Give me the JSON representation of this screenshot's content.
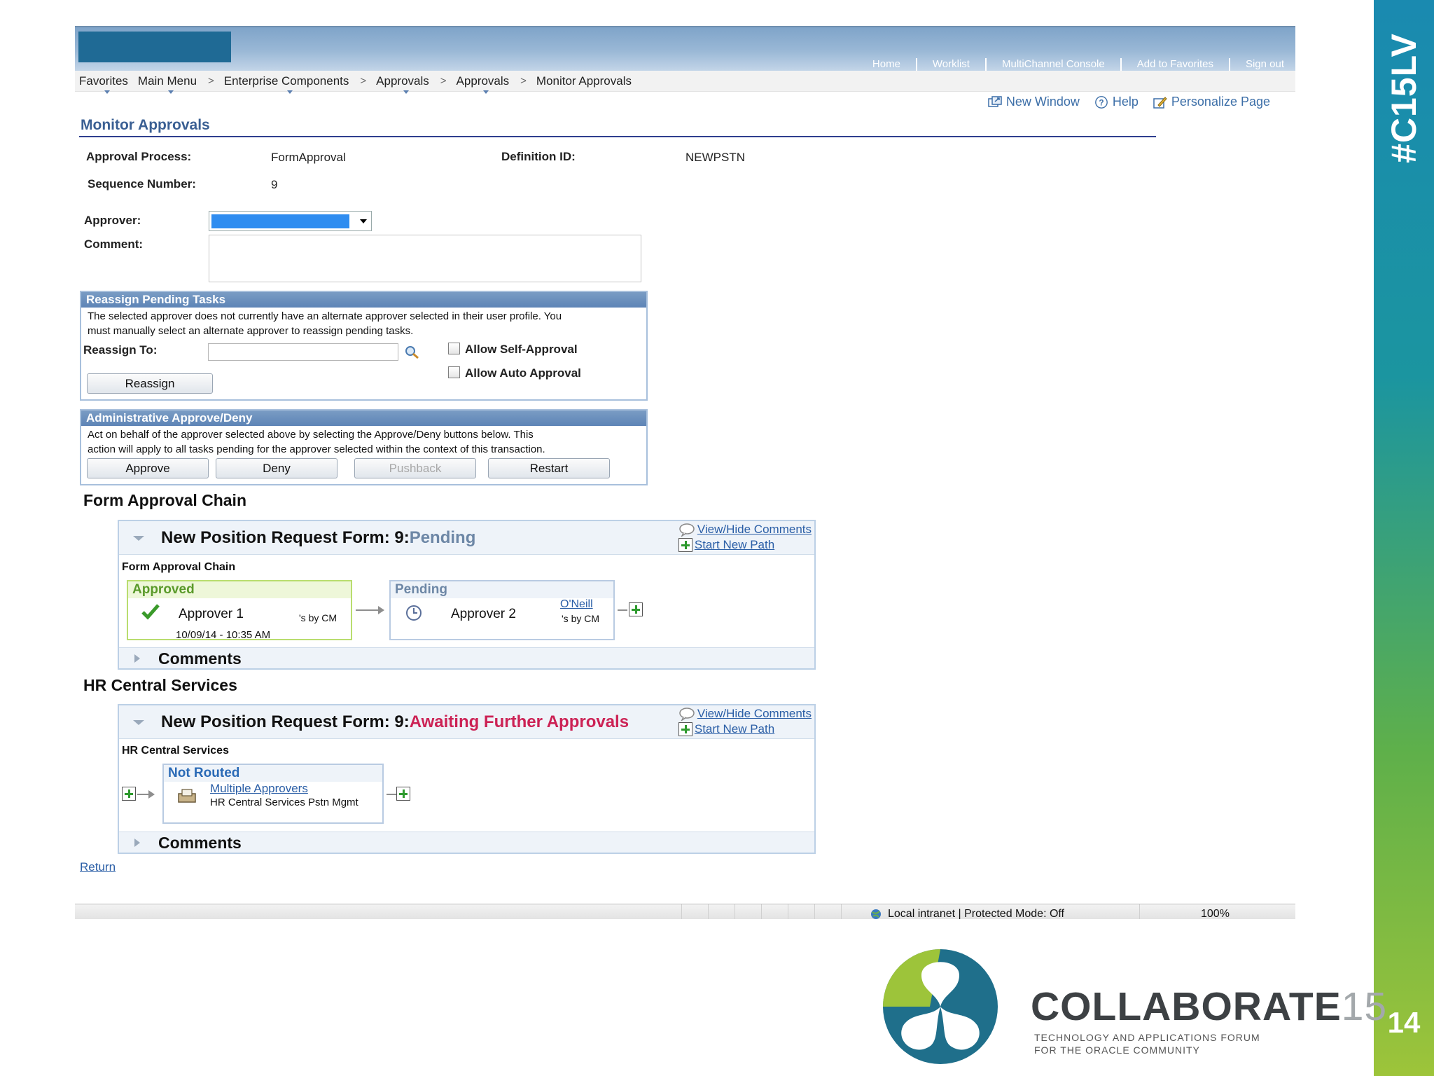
{
  "slide": {
    "hashtag": "#C15LV",
    "page_number": "14"
  },
  "topnav": {
    "links": [
      "Home",
      "Worklist",
      "MultiChannel Console",
      "Add to Favorites",
      "Sign out"
    ]
  },
  "breadcrumb": {
    "items": [
      "Favorites",
      "Main Menu",
      "Enterprise Components",
      "Approvals",
      "Approvals",
      "Monitor Approvals"
    ],
    "separator": ">"
  },
  "page_links": {
    "new_window": "New Window",
    "help": "Help",
    "personalize": "Personalize Page"
  },
  "page": {
    "title": "Monitor Approvals"
  },
  "fields": {
    "approval_process_label": "Approval Process:",
    "approval_process_value": "FormApproval",
    "definition_id_label": "Definition ID:",
    "definition_id_value": "NEWPSTN",
    "sequence_number_label": "Sequence Number:",
    "sequence_number_value": "9",
    "approver_label": "Approver:",
    "comment_label": "Comment:"
  },
  "reassign": {
    "header": "Reassign Pending Tasks",
    "message_line1": "The selected approver does not currently have an alternate approver selected in their user profile.  You",
    "message_line2": "must manually select an alternate approver to reassign pending tasks.",
    "reassign_to_label": "Reassign To:",
    "allow_self_approval": "Allow Self-Approval",
    "allow_auto_approval": "Allow Auto Approval",
    "reassign_button": "Reassign"
  },
  "admin": {
    "header": "Administrative Approve/Deny",
    "message_line1": "Act on behalf of the approver selected above by selecting the Approve/Deny buttons below.  This",
    "message_line2": "action will apply to all tasks pending for the approver selected within the context of this transaction.",
    "approve": "Approve",
    "deny": "Deny",
    "pushback": "Pushback",
    "restart": "Restart"
  },
  "form_chain": {
    "section_title": "Form Approval Chain",
    "header_prefix": "New Position Request Form: 9:",
    "status": "Pending",
    "view_hide_comments": "View/Hide Comments",
    "start_new_path": "Start New Path",
    "sub_label": "Form Approval Chain",
    "step1": {
      "status": "Approved",
      "name": "Approver 1",
      "meta": "'s by CM",
      "date": "10/09/14 - 10:35 AM"
    },
    "step2": {
      "status": "Pending",
      "name": "Approver 2",
      "link": "O'Neill",
      "meta": "'s by CM"
    },
    "comments": "Comments"
  },
  "hr_chain": {
    "section_title": "HR Central Services",
    "header_prefix": "New Position Request Form: 9:",
    "status": "Awaiting Further Approvals",
    "view_hide_comments": "View/Hide Comments",
    "start_new_path": "Start New Path",
    "sub_label": "HR Central Services",
    "step1": {
      "status": "Not Routed",
      "link": "Multiple Approvers",
      "desc": "HR Central Services Pstn Mgmt"
    },
    "comments": "Comments"
  },
  "return_link": "Return",
  "statusbar": {
    "zone": "Local intranet | Protected Mode: Off",
    "zoom": "100%"
  },
  "logo": {
    "word": "COLLABORATE",
    "number": "15",
    "tagline_line1": "TECHNOLOGY AND APPLICATIONS FORUM",
    "tagline_line2": "FOR THE ORACLE COMMUNITY"
  },
  "colors": {
    "accent": "#3a5f93",
    "link": "#2a5ea6",
    "approved": "#5a9a2a",
    "awaiting": "#cc2255",
    "strip_top": "#1a8ab0",
    "strip_bottom": "#9dc43a"
  }
}
